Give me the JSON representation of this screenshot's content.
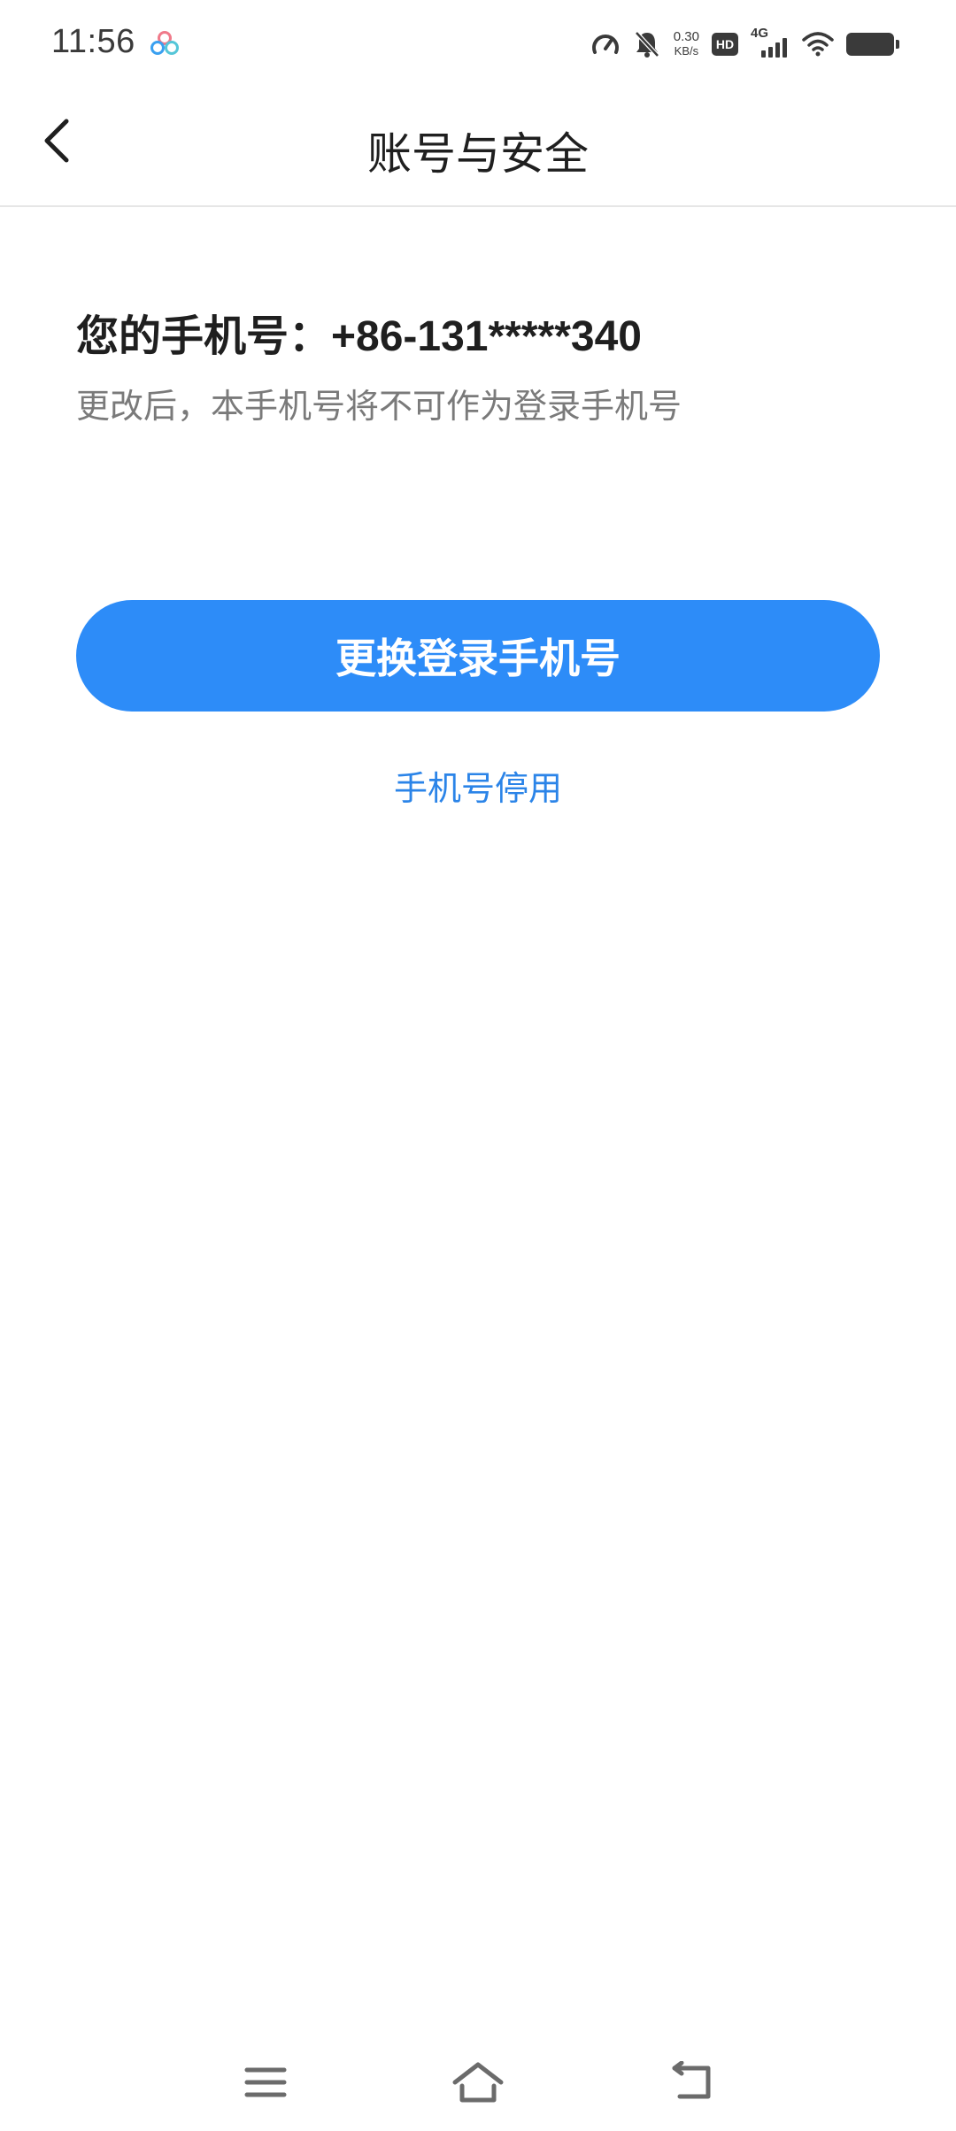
{
  "status_bar": {
    "time": "11:56",
    "net_speed_value": "0.30",
    "net_speed_unit": "KB/s",
    "hd_label": "HD",
    "network_label": "4G",
    "icons": [
      "app-cluster-icon",
      "speedometer-icon",
      "bell-muted-icon",
      "hd-icon",
      "signal-icon",
      "wifi-icon",
      "battery-icon"
    ]
  },
  "header": {
    "title": "账号与安全",
    "back_icon": "chevron-left-icon"
  },
  "content": {
    "phone_label": "您的手机号：+86-131*****340",
    "hint": "更改后，本手机号将不可作为登录手机号",
    "change_button_label": "更换登录手机号",
    "deactivate_link_label": "手机号停用"
  },
  "nav_bar": {
    "icons": [
      "menu-icon",
      "home-icon",
      "back-icon"
    ]
  },
  "colors": {
    "accent": "#2d8cf8",
    "link": "#2b84e8",
    "title": "#1f1f1f",
    "hint": "#7a7a7a",
    "divider": "#e6e6e6"
  }
}
